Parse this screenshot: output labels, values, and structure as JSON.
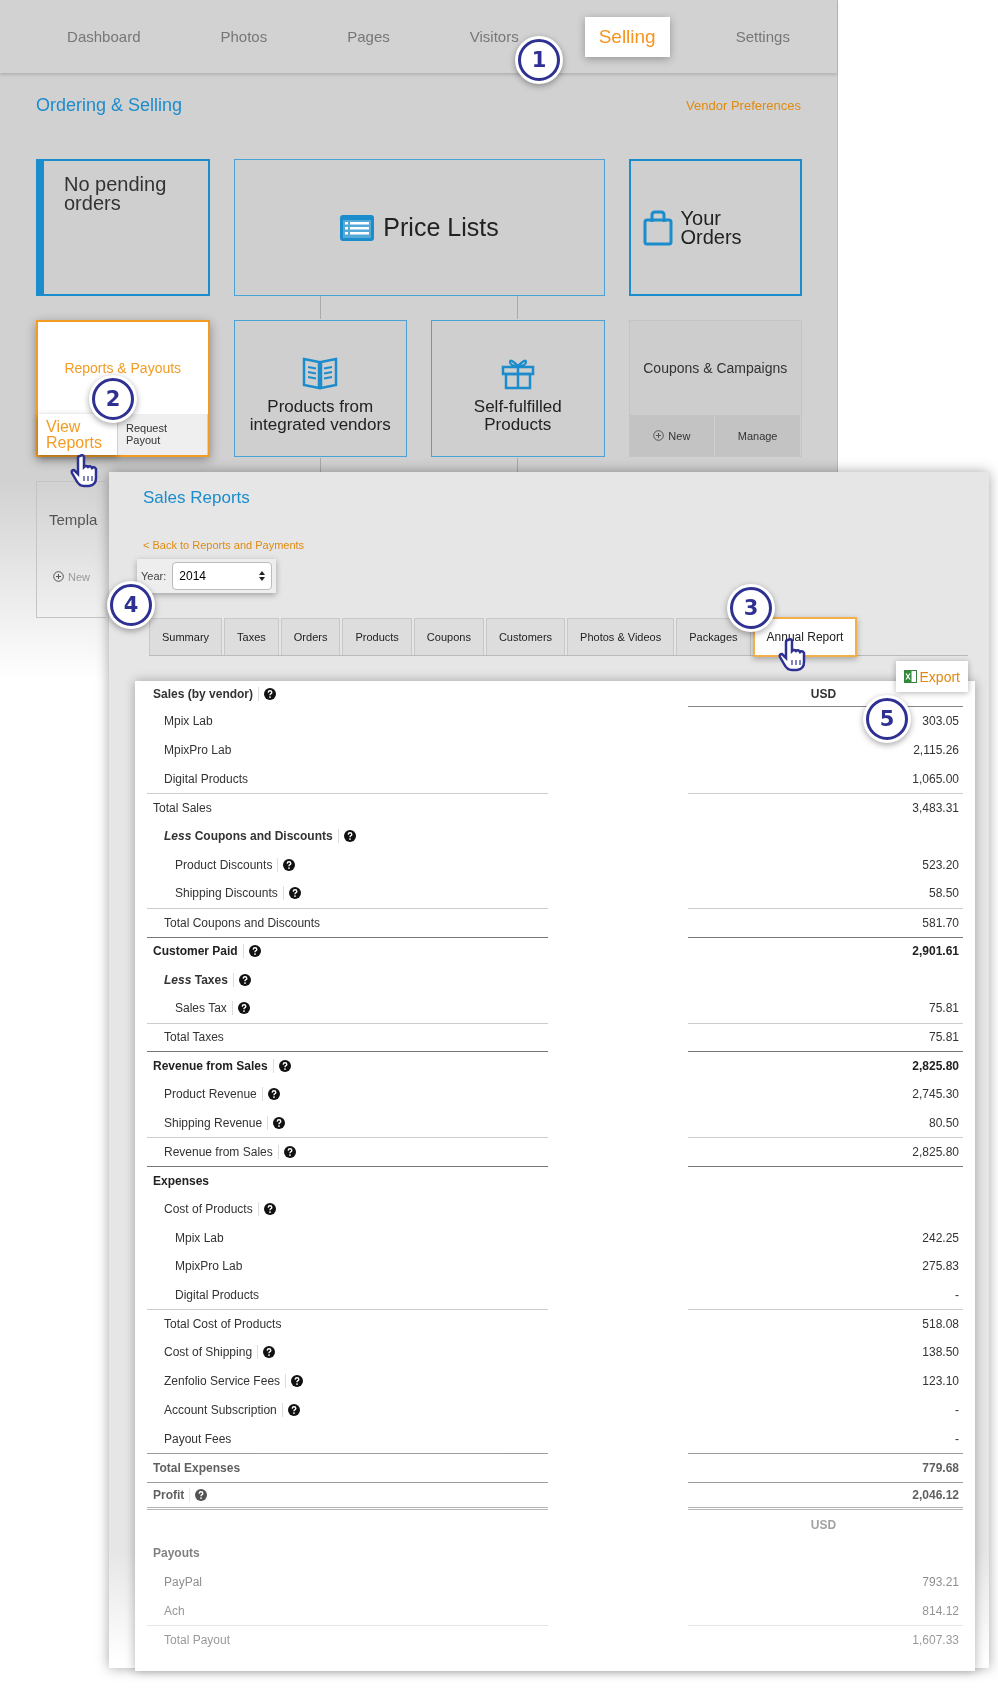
{
  "nav": {
    "tabs": [
      {
        "label": "Dashboard",
        "selected": false
      },
      {
        "label": "Photos",
        "selected": false
      },
      {
        "label": "Pages",
        "selected": false
      },
      {
        "label": "Visitors",
        "selected": false
      },
      {
        "label": "Selling",
        "selected": true
      },
      {
        "label": "Settings",
        "selected": false
      }
    ]
  },
  "page": {
    "title": "Ordering & Selling",
    "link": "Vendor Preferences"
  },
  "cards": [
    {
      "kind": "status",
      "title": "No pending orders",
      "highlighted": false
    },
    {
      "kind": "pricelists",
      "title": "Price Lists",
      "highlighted": false
    },
    {
      "kind": "orders",
      "title": "Your Orders",
      "highlighted": false
    },
    {
      "kind": "reports",
      "title": "Reports & Payouts",
      "highlighted": true,
      "actions": [
        {
          "kind": "plain",
          "label": "View Reports",
          "selected": true
        },
        {
          "kind": "plain",
          "label": "Request Payout",
          "selected": false
        }
      ]
    },
    {
      "kind": "vendors",
      "title": "Products from integrated vendors",
      "highlighted": false
    },
    {
      "kind": "products",
      "title": "Self-fulfilled Products",
      "highlighted": false
    },
    {
      "kind": "coupons",
      "title": "Coupons & Campaigns",
      "highlighted": false,
      "actions": [
        {
          "kind": "new",
          "label": "New"
        },
        {
          "kind": "plain",
          "label": "Manage"
        }
      ]
    },
    {
      "kind": "templates",
      "title": "Templa",
      "highlighted": false,
      "actions": [
        {
          "kind": "new",
          "label": "New"
        }
      ]
    }
  ],
  "sales_reports": {
    "title": "Sales Reports",
    "back_link": "< Back to Reports and Payments",
    "year": {
      "label": "Year:",
      "value": "2014"
    },
    "tabs": [
      {
        "label": "Summary",
        "selected": false
      },
      {
        "label": "Taxes",
        "selected": false
      },
      {
        "label": "Orders",
        "selected": false
      },
      {
        "label": "Products",
        "selected": false
      },
      {
        "label": "Coupons",
        "selected": false
      },
      {
        "label": "Customers",
        "selected": false
      },
      {
        "label": "Photos & Videos",
        "selected": false
      },
      {
        "label": "Packages",
        "selected": false
      },
      {
        "label": "Annual Report",
        "selected": true
      }
    ],
    "export": "Export",
    "rows": [
      {
        "kind": "header",
        "label": "Sales (by vendor)",
        "help": true,
        "value": "USD",
        "children": [
          {
            "kind": "item",
            "label": "Mpix Lab",
            "value": "303.05"
          },
          {
            "kind": "item",
            "label": "MpixPro Lab",
            "value": "2,115.26"
          },
          {
            "kind": "item",
            "label": "Digital Products",
            "value": "1,065.00"
          }
        ]
      },
      {
        "kind": "subtotal",
        "label": "Total Sales",
        "value": "3,483.31",
        "children": [
          {
            "kind": "heading",
            "label": "*Less* Coupons and Discounts",
            "help": true,
            "children": [
              {
                "kind": "item",
                "label": "Product Discounts",
                "help": true,
                "value": "523.20"
              },
              {
                "kind": "item",
                "label": "Shipping Discounts",
                "help": true,
                "value": "58.50"
              }
            ]
          },
          {
            "kind": "subtotal",
            "label": "Total Coupons and Discounts",
            "value": "581.70"
          }
        ]
      },
      {
        "kind": "section",
        "label": "Customer Paid",
        "help": true,
        "value": "2,901.61",
        "children": [
          {
            "kind": "heading",
            "label": "*Less* Taxes",
            "help": true,
            "children": [
              {
                "kind": "item",
                "label": "Sales Tax",
                "help": true,
                "value": "75.81"
              }
            ]
          },
          {
            "kind": "subtotal",
            "label": "Total Taxes",
            "value": "75.81"
          }
        ]
      },
      {
        "kind": "section",
        "label": "Revenue from Sales",
        "help": true,
        "value": "2,825.80",
        "children": [
          {
            "kind": "item",
            "label": "Product Revenue",
            "help": true,
            "value": "2,745.30"
          },
          {
            "kind": "item",
            "label": "Shipping Revenue",
            "help": true,
            "value": "80.50"
          },
          {
            "kind": "subtotal",
            "label": "Revenue from Sales",
            "help": true,
            "value": "2,825.80"
          }
        ]
      },
      {
        "kind": "section",
        "label": "Expenses",
        "children": [
          {
            "kind": "item",
            "label": "Cost of Products",
            "help": true,
            "children": [
              {
                "kind": "item",
                "label": "Mpix Lab",
                "value": "242.25"
              },
              {
                "kind": "item",
                "label": "MpixPro Lab",
                "value": "275.83"
              },
              {
                "kind": "item",
                "label": "Digital Products",
                "value": "-"
              }
            ]
          },
          {
            "kind": "subtotal",
            "label": "Total Cost of Products",
            "value": "518.08"
          },
          {
            "kind": "item",
            "label": "Cost of Shipping",
            "help": true,
            "value": "138.50"
          },
          {
            "kind": "item",
            "label": "Zenfolio Service Fees",
            "help": true,
            "value": "123.10"
          },
          {
            "kind": "item",
            "label": "Account Subscription",
            "help": true,
            "value": "-"
          },
          {
            "kind": "item",
            "label": "Payout Fees",
            "value": "-"
          }
        ]
      },
      {
        "kind": "section",
        "label": "Total Expenses",
        "value": "779.68"
      },
      {
        "kind": "final",
        "label": "Profit",
        "help": true,
        "value": "2,046.12"
      }
    ],
    "payouts": {
      "currency": "USD",
      "title": "Payouts",
      "rows": [
        {
          "kind": "item",
          "label": "PayPal",
          "value": "793.21"
        },
        {
          "kind": "item",
          "label": "Ach",
          "value": "814.12"
        },
        {
          "kind": "subtotal",
          "label": "Total Payout",
          "value": "1,607.33"
        }
      ]
    }
  },
  "callouts": [
    {
      "number": "1"
    },
    {
      "number": "2"
    },
    {
      "number": "3"
    },
    {
      "number": "4"
    },
    {
      "number": "5"
    }
  ]
}
